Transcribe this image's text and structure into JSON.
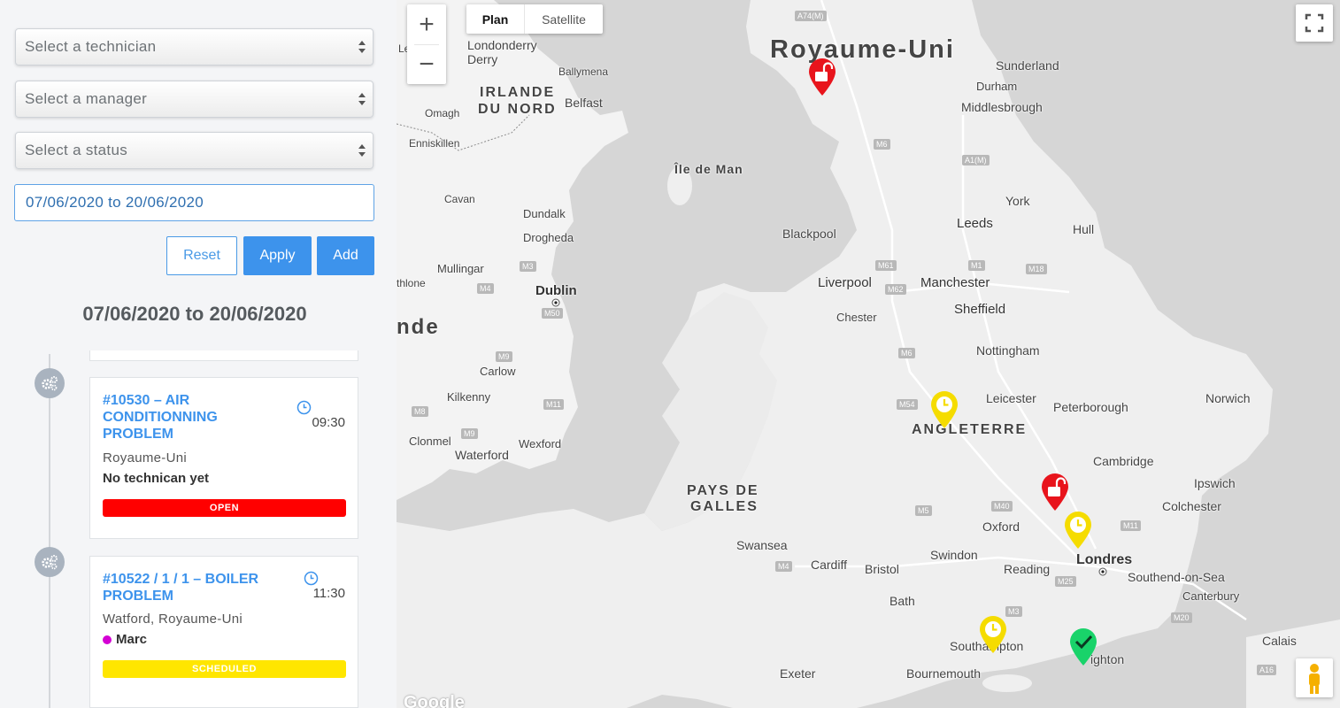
{
  "filters": {
    "technician_placeholder": "Select a technician",
    "manager_placeholder": "Select a manager",
    "status_placeholder": "Select a status",
    "date_range_value": "07/06/2020 to 20/06/2020"
  },
  "buttons": {
    "reset": "Reset",
    "apply": "Apply",
    "add": "Add"
  },
  "range_title": "07/06/2020 to 20/06/2020",
  "tickets": [
    {
      "title": "#10530 – AIR CONDITIONNING PROBLEM",
      "time": "09:30",
      "location": "Royaume-Uni",
      "technician": "No technican yet",
      "status": "OPEN",
      "status_color": "#ff0000"
    },
    {
      "title": "#10522 / 1 / 1 – BOILER PROBLEM",
      "time": "11:30",
      "location": "Watford, Royaume-Uni",
      "technician": "Marc",
      "technician_color": "#d400d4",
      "status": "SCHEDULED",
      "status_color": "#ffe600"
    }
  ],
  "map": {
    "zoom_in": "+",
    "zoom_out": "−",
    "type_plan": "Plan",
    "type_satellite": "Satellite",
    "google_logo": "Google",
    "labels": {
      "royaume_uni": "Royaume-Uni",
      "irlande_nord_1": "IRLANDE",
      "irlande_nord_2": "DU NORD",
      "angleterre": "ANGLETERRE",
      "pays_de_galles_1": "PAYS DE",
      "pays_de_galles_2": "GALLES",
      "ile_de_man": "Île de Man",
      "irlande_partial": "nde",
      "londonderry": "Londonderry",
      "derry": "Derry",
      "ballymena": "Ballymena",
      "belfast": "Belfast",
      "omagh": "Omagh",
      "enniskillen": "Enniskillen",
      "cavan": "Cavan",
      "dundalk": "Dundalk",
      "drogheda": "Drogheda",
      "mullingar": "Mullingar",
      "athlone": "thlone",
      "dublin": "Dublin",
      "carlow": "Carlow",
      "kilkenny": "Kilkenny",
      "clonmel": "Clonmel",
      "waterford": "Waterford",
      "wexford": "Wexford",
      "sunderland": "Sunderland",
      "durham": "Durham",
      "middlesbrough": "Middlesbrough",
      "york": "York",
      "leeds": "Leeds",
      "hull": "Hull",
      "blackpool": "Blackpool",
      "liverpool": "Liverpool",
      "manchester": "Manchester",
      "sheffield": "Sheffield",
      "chester": "Chester",
      "nottingham": "Nottingham",
      "leicester": "Leicester",
      "peterborough": "Peterborough",
      "norwich": "Norwich",
      "cambridge": "Cambridge",
      "ipswich": "Ipswich",
      "colchester": "Colchester",
      "oxford": "Oxford",
      "swindon": "Swindon",
      "reading": "Reading",
      "londres": "Londres",
      "southend": "Southend-on-Sea",
      "canterbury": "Canterbury",
      "swansea": "Swansea",
      "cardiff": "Cardiff",
      "bristol": "Bristol",
      "bath": "Bath",
      "southampton": "Southampton",
      "brighton": "ighton",
      "bournemouth": "Bournemouth",
      "exeter": "Exeter",
      "calais": "Calais",
      "le": "Le"
    },
    "roads": {
      "a74m": "A74(M)",
      "m6a": "M6",
      "a1m": "A1(M)",
      "m61": "M61",
      "m62": "M62",
      "m1": "M1",
      "m18": "M18",
      "m6b": "M6",
      "m54": "M54",
      "m40": "M40",
      "m5": "M5",
      "m11": "M11",
      "m4": "M4",
      "m25": "M25",
      "m3": "M3",
      "m20": "M20",
      "a16": "A16",
      "m3ie": "M3",
      "m4ie": "M4",
      "m50": "M50",
      "m9": "M9",
      "m8": "M8",
      "m9b": "M9",
      "m11ie": "M11"
    },
    "markers": [
      {
        "kind": "open",
        "color": "#e8141c"
      },
      {
        "kind": "scheduled",
        "color": "#f5dc00"
      },
      {
        "kind": "open",
        "color": "#e8141c"
      },
      {
        "kind": "scheduled",
        "color": "#f5dc00"
      },
      {
        "kind": "scheduled",
        "color": "#f5dc00"
      },
      {
        "kind": "done",
        "color": "#19d36a"
      }
    ]
  }
}
